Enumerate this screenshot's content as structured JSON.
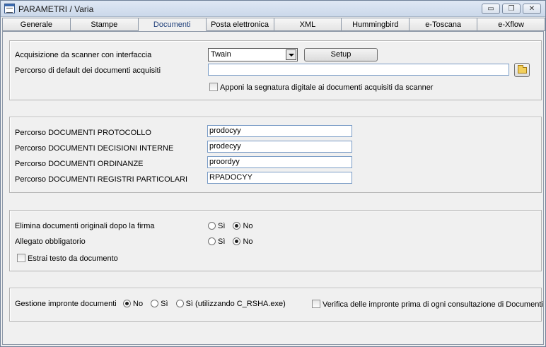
{
  "window": {
    "title": "PARAMETRI / Varia",
    "minimize_glyph": "▭",
    "restore_glyph": "❐",
    "close_glyph": "✕"
  },
  "tabs": [
    {
      "label": "Generale"
    },
    {
      "label": "Stampe"
    },
    {
      "label": "Documenti"
    },
    {
      "label": "Posta elettronica"
    },
    {
      "label": "XML"
    },
    {
      "label": "Hummingbird"
    },
    {
      "label": "e-Toscana"
    },
    {
      "label": "e-Xflow"
    }
  ],
  "active_tab": "Documenti",
  "scanner": {
    "interface_label": "Acquisizione da scanner con interfaccia",
    "interface_value": "Twain",
    "setup_label": "Setup",
    "default_path_label": "Percorso di default dei documenti acquisiti",
    "default_path_value": "",
    "digital_signature_label": "Apponi la segnatura digitale ai documenti acquisiti da scanner",
    "digital_signature_checked": false
  },
  "paths": {
    "protocollo_label": "Percorso DOCUMENTI PROTOCOLLO",
    "protocollo_value": "prodocyy",
    "decisioni_label": "Percorso DOCUMENTI DECISIONI INTERNE",
    "decisioni_value": "prodecyy",
    "ordinanze_label": "Percorso DOCUMENTI ORDINANZE",
    "ordinanze_value": "proordyy",
    "registri_label": "Percorso DOCUMENTI REGISTRI PARTICOLARI",
    "registri_value": "RPADOCYY"
  },
  "options": {
    "elimina_label": "Elimina documenti originali dopo la firma",
    "allegato_label": "Allegato obbligatorio",
    "si_label": "Sì",
    "no_label": "No",
    "elimina_selected": "No",
    "allegato_selected": "No",
    "estrai_label": "Estrai testo da documento",
    "estrai_checked": false
  },
  "impronte": {
    "label": "Gestione impronte documenti",
    "opt_no": "No",
    "opt_si": "Sì",
    "opt_si_rsha": "Sì  (utilizzando C_RSHA.exe)",
    "selected": "No",
    "verifica_label": "Verifica delle impronte prima di ogni consultazione di Documenti",
    "verifica_checked": false
  }
}
